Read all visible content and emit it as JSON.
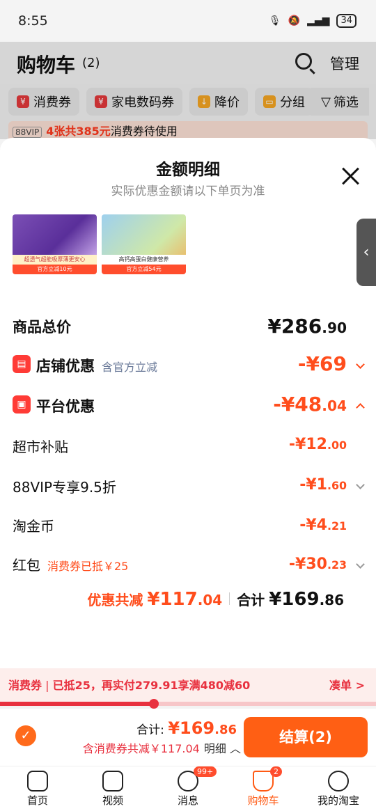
{
  "status": {
    "time": "8:55",
    "battery": "34"
  },
  "header": {
    "title": "购物车",
    "count": "(2)",
    "manage": "管理"
  },
  "chips": [
    {
      "label": "消费券",
      "icon": "coupon-icon"
    },
    {
      "label": "家电数码券",
      "icon": "coupon-icon"
    },
    {
      "label": "降价",
      "icon": "arrow-down-icon"
    },
    {
      "label": "分组",
      "icon": "folder-icon"
    }
  ],
  "filter_label": "筛选",
  "vip_bar": {
    "badge": "88VIP",
    "text_red": "4张共385元",
    "text": "消费券待使用"
  },
  "panel": {
    "title": "金额明细",
    "subtitle": "实际优惠金额请以下单页为准",
    "thumbs": [
      {
        "caption": "超透气超能吸厚薄更安心",
        "banner": "官方立减10元"
      },
      {
        "caption": "高钙高蛋白健康营养",
        "banner": "官方立减54元"
      }
    ],
    "rows": {
      "total": {
        "label": "商品总价",
        "value": "¥286",
        "dec": ".90"
      },
      "shop": {
        "label": "店铺优惠",
        "note": "含官方立减",
        "value": "-¥69"
      },
      "platform": {
        "label": "平台优惠",
        "value": "-¥48",
        "dec": ".04"
      },
      "supermarket": {
        "label": "超市补贴",
        "value": "-¥12",
        "dec": ".00"
      },
      "vip": {
        "label": "88VIP专享9.5折",
        "value": "-¥1",
        "dec": ".60"
      },
      "coin": {
        "label": "淘金币",
        "value": "-¥4",
        "dec": ".21"
      },
      "redpack": {
        "label": "红包",
        "note": "消费券已抵￥25",
        "value": "-¥30",
        "dec": ".23"
      }
    },
    "summary": {
      "discount_label": "优惠共减",
      "discount_value": "¥117",
      "discount_dec": ".04",
      "total_label": "合计",
      "total_value": "¥169",
      "total_dec": ".86"
    }
  },
  "coupon_strip": {
    "label": "消费券",
    "text": "已抵25，再实付279.91享满480减60",
    "more": "凑单 >",
    "progress": 0.41
  },
  "checkout": {
    "total_label": "合计:",
    "total_value": "¥169",
    "total_dec": ".86",
    "savings": "含消费券共减￥117.04",
    "detail": "明细",
    "button": "结算(2)"
  },
  "nav": [
    {
      "label": "首页",
      "icon": "home-icon"
    },
    {
      "label": "视频",
      "icon": "video-icon"
    },
    {
      "label": "消息",
      "icon": "message-icon",
      "badge": "99+"
    },
    {
      "label": "购物车",
      "icon": "cart-icon",
      "badge": "2",
      "active": true
    },
    {
      "label": "我的淘宝",
      "icon": "profile-icon"
    }
  ]
}
